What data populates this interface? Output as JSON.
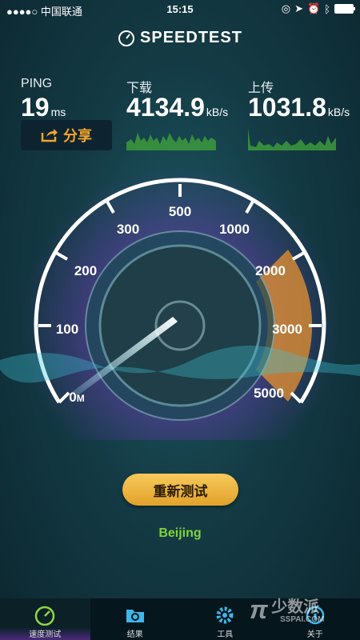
{
  "status_bar": {
    "carrier": "●●●●○ 中国联通",
    "time": "15:15"
  },
  "app": {
    "title": "SPEEDTEST"
  },
  "ping": {
    "label": "PING",
    "value": "19",
    "unit": "ms"
  },
  "download": {
    "label": "下载",
    "value": "4134.9",
    "unit": "kB/s"
  },
  "upload": {
    "label": "上传",
    "value": "1031.8",
    "unit": "kB/s"
  },
  "share": {
    "label": "分享"
  },
  "gauge": {
    "ticks": [
      "0",
      "100",
      "200",
      "300",
      "500",
      "1000",
      "2000",
      "3000",
      "5000"
    ],
    "unit_marker": "M",
    "needle_value": 0
  },
  "retest": {
    "label": "重新测试"
  },
  "server": {
    "name": "Beijing"
  },
  "tabs": [
    {
      "label": "速度测试",
      "icon": "gauge-icon",
      "active": true
    },
    {
      "label": "结果",
      "icon": "folder-icon",
      "active": false
    },
    {
      "label": "工具",
      "icon": "gear-icon",
      "active": false
    },
    {
      "label": "关于",
      "icon": "info-icon",
      "active": false
    }
  ],
  "watermark": {
    "text": "少数派",
    "sub": "SSPAI.COM"
  },
  "colors": {
    "accent": "#f3a52b",
    "server": "#7ed43a",
    "arc_upload": "#e8932f"
  }
}
